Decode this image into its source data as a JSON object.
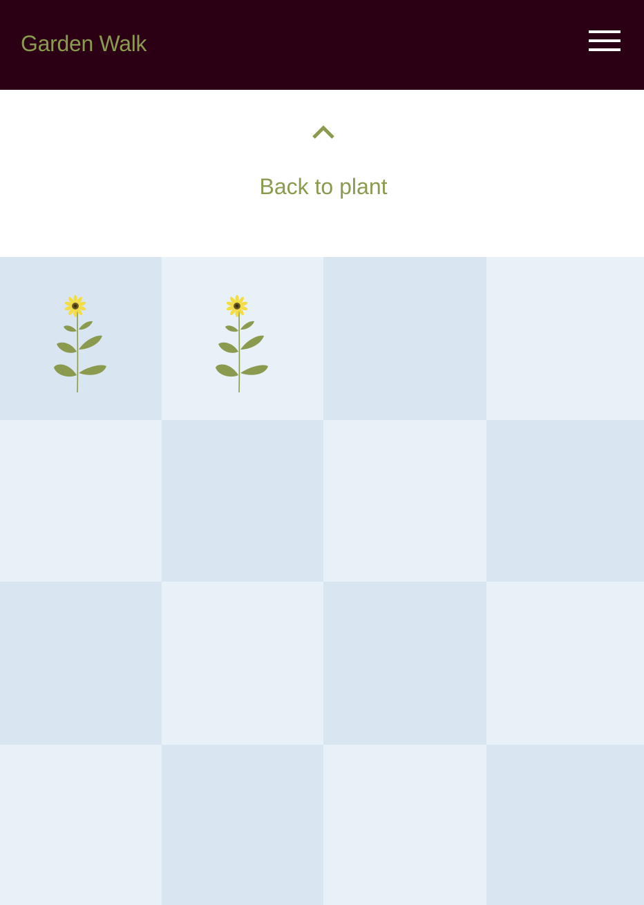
{
  "header": {
    "brand": "Garden Walk",
    "menu_icon": "hamburger-menu-icon",
    "background": "#2c0014",
    "brand_color": "#8a9a4f"
  },
  "back": {
    "icon": "chevron-up-icon",
    "label": "Back to plant",
    "color": "#8a9a4f"
  },
  "grid": {
    "rows": 4,
    "columns": 4,
    "colors": {
      "dark": "#d9e6f1",
      "light": "#e8f0f8"
    },
    "cells": [
      {
        "row": 1,
        "col": 1,
        "plant": "sunflower-plant-icon"
      },
      {
        "row": 1,
        "col": 2,
        "plant": "sunflower-plant-icon"
      },
      {
        "row": 1,
        "col": 3,
        "plant": null
      },
      {
        "row": 1,
        "col": 4,
        "plant": null
      },
      {
        "row": 2,
        "col": 1,
        "plant": null
      },
      {
        "row": 2,
        "col": 2,
        "plant": null
      },
      {
        "row": 2,
        "col": 3,
        "plant": null
      },
      {
        "row": 2,
        "col": 4,
        "plant": null
      },
      {
        "row": 3,
        "col": 1,
        "plant": null
      },
      {
        "row": 3,
        "col": 2,
        "plant": null
      },
      {
        "row": 3,
        "col": 3,
        "plant": null
      },
      {
        "row": 3,
        "col": 4,
        "plant": null
      },
      {
        "row": 4,
        "col": 1,
        "plant": null
      },
      {
        "row": 4,
        "col": 2,
        "plant": null
      },
      {
        "row": 4,
        "col": 3,
        "plant": null
      },
      {
        "row": 4,
        "col": 4,
        "plant": null
      }
    ]
  }
}
